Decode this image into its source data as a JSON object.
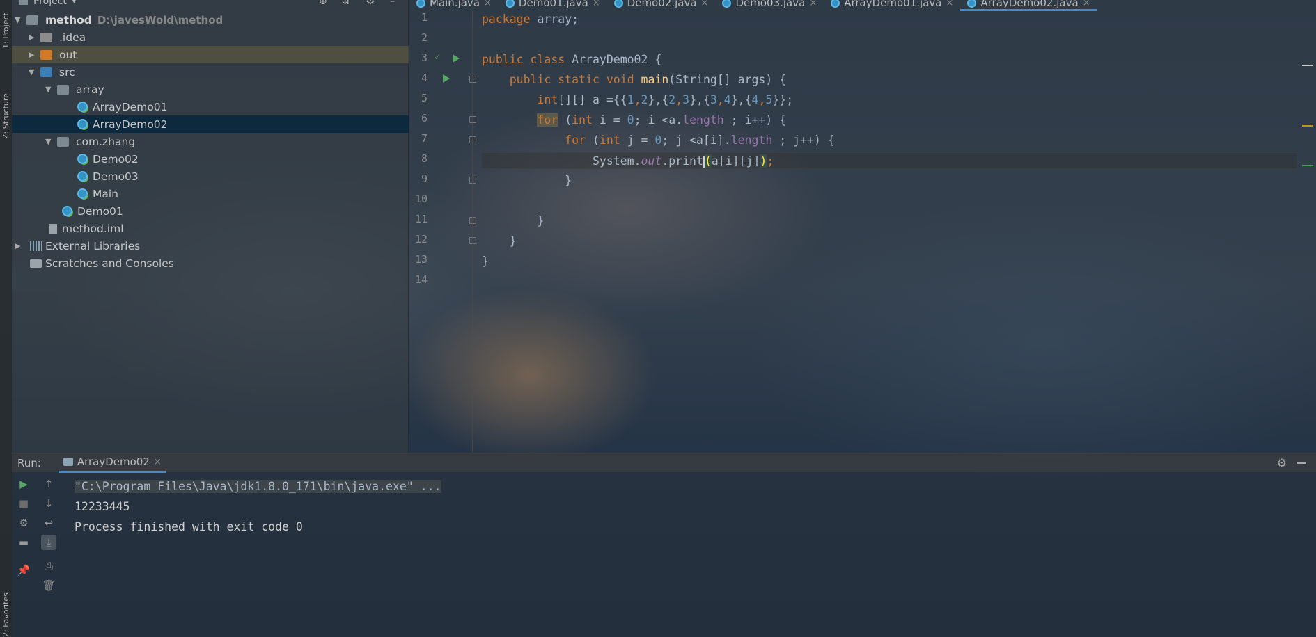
{
  "left_strip": {
    "project_tab": "1: Project",
    "structure_tab": "Z: Structure",
    "favorites_tab": "2: Favorites"
  },
  "project_panel": {
    "header_title": "Project",
    "tree": {
      "root_label": "method",
      "root_path": "D:\\javesWold\\method",
      "idea": ".idea",
      "out": "out",
      "src": "src",
      "array_pkg": "array",
      "array_demo01": "ArrayDemo01",
      "array_demo02": "ArrayDemo02",
      "com_zhang": "com.zhang",
      "demo02": "Demo02",
      "demo03": "Demo03",
      "main": "Main",
      "demo01": "Demo01",
      "iml": "method.iml",
      "external_libs": "External Libraries",
      "scratches": "Scratches and Consoles"
    }
  },
  "editor": {
    "tabs": [
      "Main.java",
      "Demo01.java",
      "Demo02.java",
      "Demo03.java",
      "ArrayDemo01.java",
      "ArrayDemo02.java"
    ],
    "active_tab_index": 5,
    "line_numbers": [
      "1",
      "2",
      "3",
      "4",
      "5",
      "6",
      "7",
      "8",
      "9",
      "10",
      "11",
      "12",
      "13",
      "14"
    ],
    "code": {
      "l1_pkg": "package",
      "l1_rest": " array;",
      "l3_public": "public",
      "l3_class": "class",
      "l3_rest": " ArrayDemo02 {",
      "l4_indent": "    ",
      "l4_public": "public",
      "l4_static": "static",
      "l4_void": "void",
      "l4_main": "main",
      "l4_rest": "(String[] args) {",
      "l5_indent": "        ",
      "l5_int": "int",
      "l5_a": "[][] a ={{",
      "n1": "1",
      "c1": ",",
      "n2": "2",
      "c2": "},{",
      "n3": "2",
      "c3": ",",
      "n4": "3",
      "c4": "},{",
      "n5": "3",
      "c5": ",",
      "n6": "4",
      "c6": "},{",
      "n7": "4",
      "c7": ",",
      "n8": "5",
      "c8": "}};",
      "l6_indent": "        ",
      "l6_for": "for",
      "l6_p1": " (",
      "l6_int": "int",
      "l6_p2": " i = ",
      "l6_zero": "0",
      "l6_p3": "; i <a.",
      "l6_length": "length",
      "l6_p4": " ; i++) {",
      "l7_indent": "            ",
      "l7_for": "for",
      "l7_p1": " (",
      "l7_int": "int",
      "l7_p2": " j = ",
      "l7_zero": "0",
      "l7_p3": "; j <a[i].",
      "l7_length": "length",
      "l7_p4": " ; j++) {",
      "l8_indent": "                ",
      "l8_system": "System.",
      "l8_out": "out",
      "l8_print": ".print",
      "l8_open": "(",
      "l8_args": "a[i][j]",
      "l8_close": ")",
      "l8_semi": ";",
      "l9": "            }",
      "l11": "        }",
      "l12": "    }",
      "l13": "}"
    }
  },
  "run_panel": {
    "label": "Run:",
    "tab_label": "ArrayDemo02",
    "console": {
      "cmd": "\"C:\\Program Files\\Java\\jdk1.8.0_171\\bin\\java.exe\" ...",
      "output": "12233445",
      "exit": "Process finished with exit code 0"
    }
  },
  "colors": {
    "keyword": "#cc7832",
    "function": "#ffc66d",
    "number": "#6897bb",
    "field": "#9876aa",
    "selection": "#0d293e",
    "accent": "#4a88c7",
    "run_green": "#59a869"
  }
}
